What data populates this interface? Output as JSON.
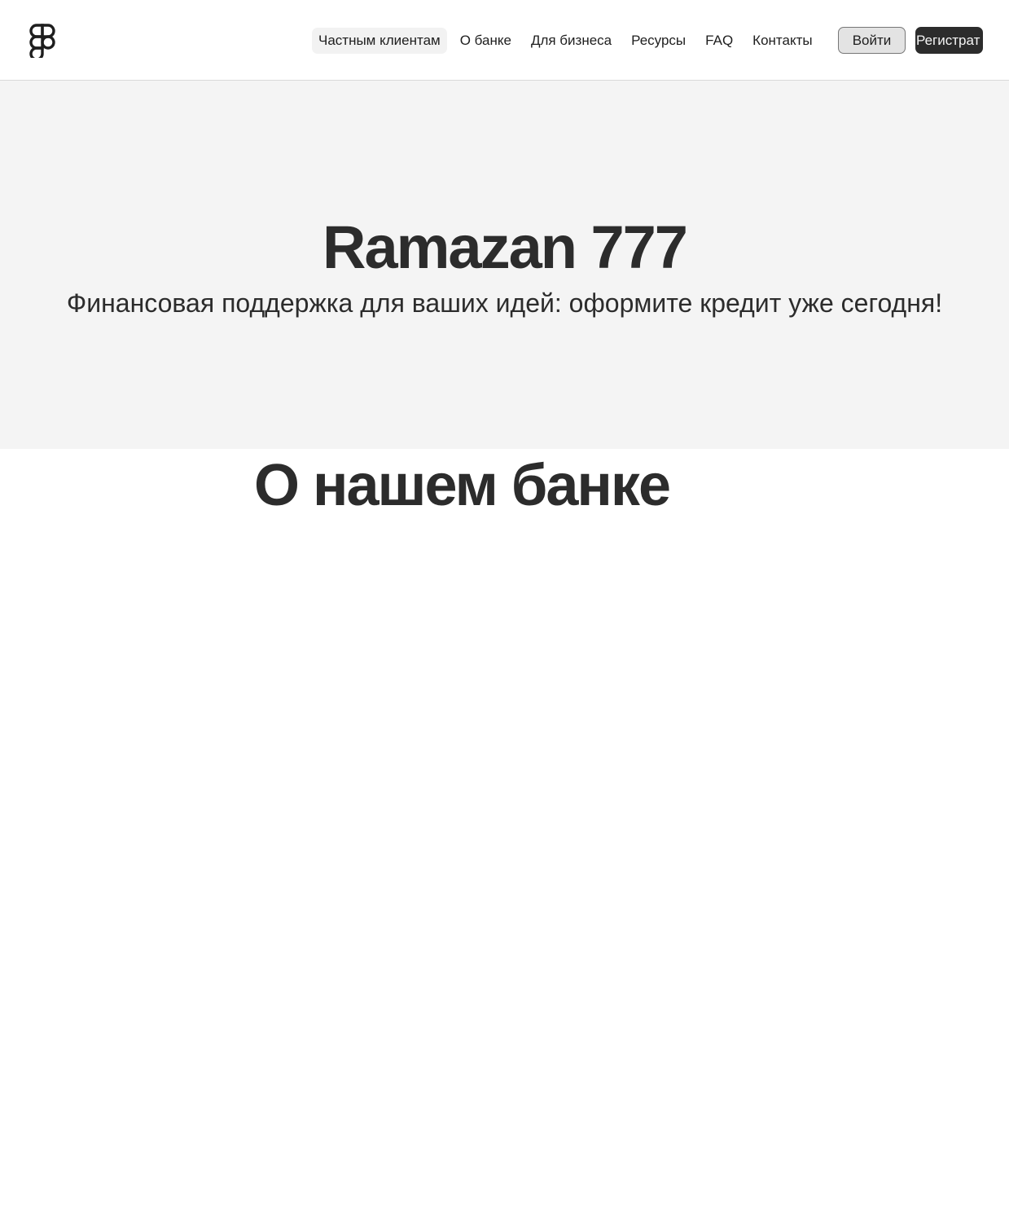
{
  "header": {
    "logo_icon": "figma-logo-icon",
    "nav": [
      {
        "label": "Частным клиентам",
        "active": true
      },
      {
        "label": "О банке",
        "active": false
      },
      {
        "label": "Для бизнеса",
        "active": false
      },
      {
        "label": "Ресурсы",
        "active": false
      },
      {
        "label": "FAQ",
        "active": false
      },
      {
        "label": "Контакты",
        "active": false
      }
    ],
    "login_label": "Войти",
    "register_label": "Регистрат"
  },
  "hero": {
    "title": "Ramazan 777",
    "subtitle": "Финансовая поддержка для ваших идей: оформите кредит уже сегодня!"
  },
  "about": {
    "title": "О нашем банке"
  },
  "colors": {
    "text": "#2c2c2c",
    "hero_bg": "#f4f4f4",
    "primary_button": "#2c2c2c",
    "secondary_button": "#e3e3e3"
  }
}
